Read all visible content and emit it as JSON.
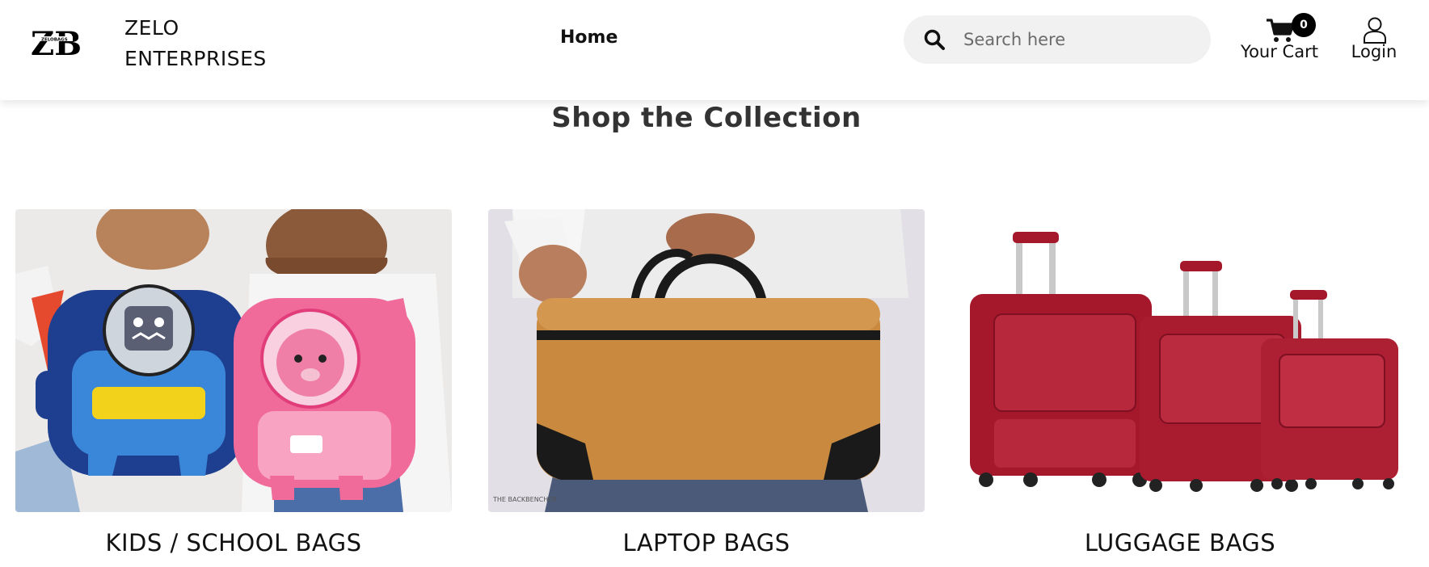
{
  "brand": {
    "logo_text": "ZB",
    "logo_subtext": "ZELOBAGS",
    "name_line1": "ZELO",
    "name_line2": "ENTERPRISES"
  },
  "nav": {
    "home": "Home"
  },
  "search": {
    "placeholder": "Search here",
    "value": ""
  },
  "cart": {
    "label": "Your Cart",
    "count": "0"
  },
  "login": {
    "label": "Login"
  },
  "section": {
    "title": "Shop the Collection"
  },
  "collections": [
    {
      "label": "KIDS / SCHOOL BAGS",
      "image": "kids-backpacks-photo"
    },
    {
      "label": "LAPTOP BAGS",
      "image": "laptop-bag-photo"
    },
    {
      "label": "LUGGAGE BAGS",
      "image": "red-luggage-set-photo"
    }
  ],
  "colors": {
    "backpack_blue": "#1e3f8f",
    "backpack_pink": "#f06a9a",
    "laptop_bag_tan": "#c98a3f",
    "luggage_red": "#a5182c"
  }
}
